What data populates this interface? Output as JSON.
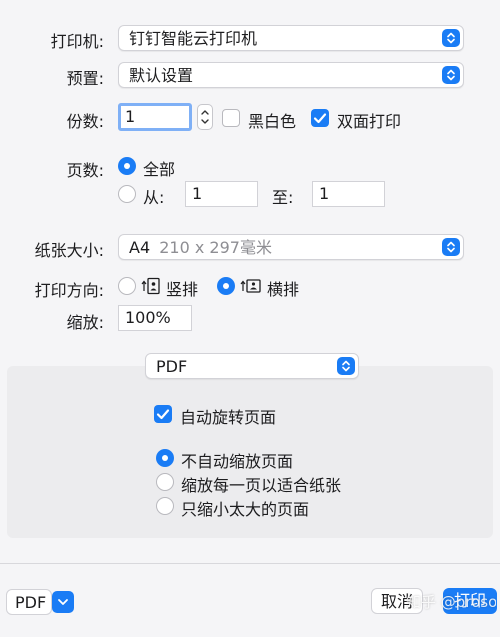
{
  "printer": {
    "label": "打印机:",
    "value": "钉钉智能云打印机"
  },
  "preset": {
    "label": "预置:",
    "value": "默认设置"
  },
  "copies": {
    "label": "份数:",
    "value": "1",
    "bw_label": "黑白色",
    "bw_checked": false,
    "duplex_label": "双面打印",
    "duplex_checked": true
  },
  "pages": {
    "label": "页数:",
    "all_label": "全部",
    "from_label": "从:",
    "from_value": "1",
    "to_label": "至:",
    "to_value": "1"
  },
  "paper_size": {
    "label": "纸张大小:",
    "value": "A4",
    "detail": "210 x 297毫米"
  },
  "orientation": {
    "label": "打印方向:",
    "portrait_label": "竖排",
    "landscape_label": "横排"
  },
  "scale": {
    "label": "缩放:",
    "value": "100%"
  },
  "section_popup": {
    "value": "PDF"
  },
  "options": {
    "auto_rotate": "自动旋转页面",
    "no_scale": "不自动缩放页面",
    "fit_paper": "缩放每一页以适合纸张",
    "shrink_large": "只缩小太大的页面"
  },
  "footer": {
    "pdf_label": "PDF",
    "cancel_label": "取消",
    "print_label": "打印"
  },
  "watermark": "知乎 @prosoul",
  "colors": {
    "accent": "#1a7cf5",
    "background": "#f5f5f7",
    "panel": "#ececee"
  }
}
